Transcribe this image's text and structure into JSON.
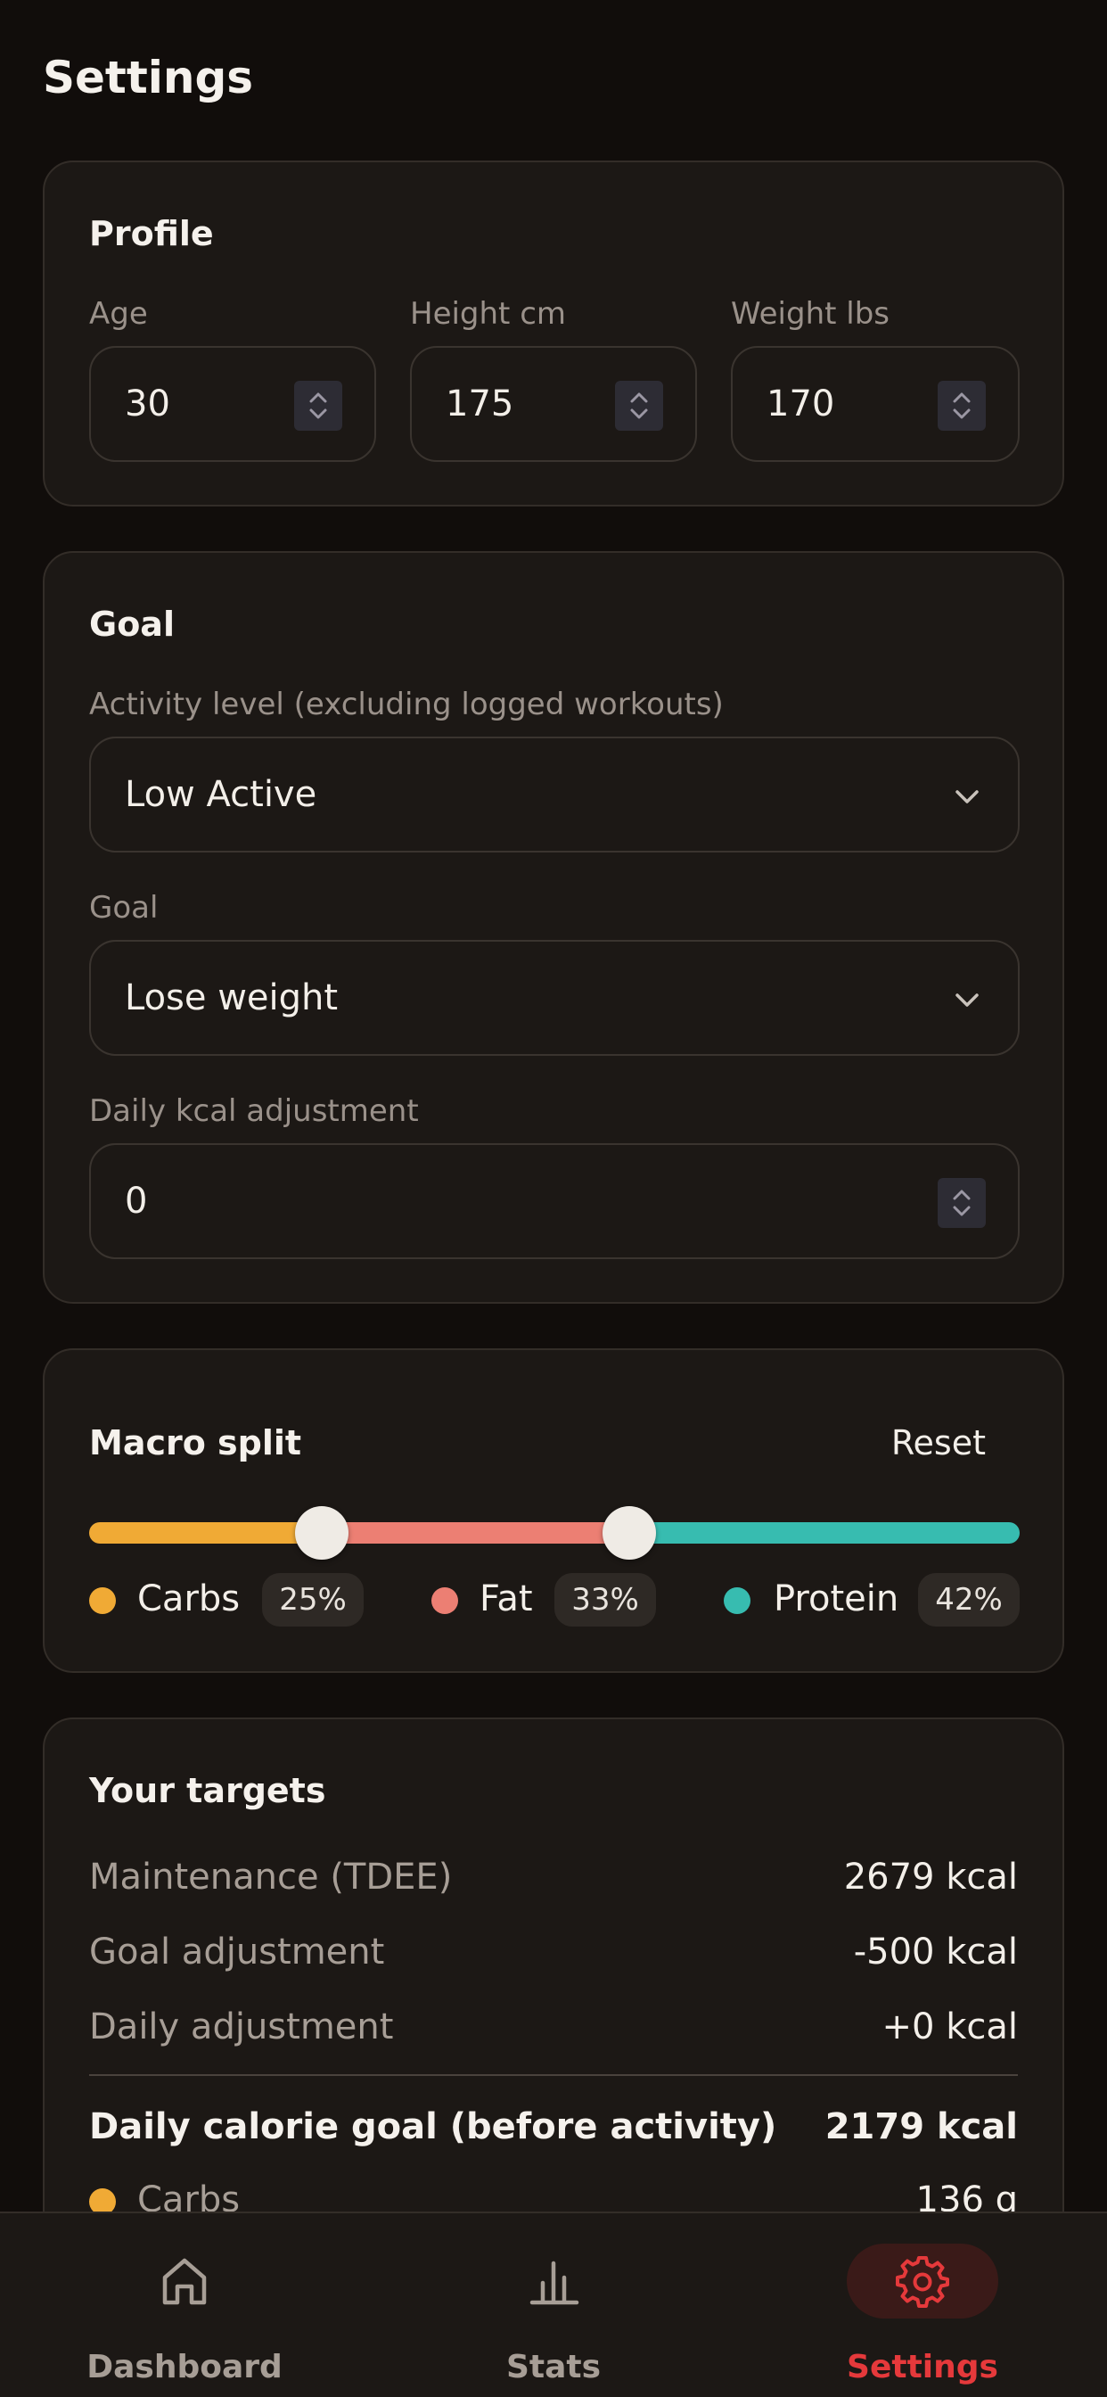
{
  "page": {
    "title": "Settings"
  },
  "profile": {
    "title": "Profile",
    "fields": [
      {
        "label": "Age",
        "value": "30"
      },
      {
        "label": "Height cm",
        "value": "175"
      },
      {
        "label": "Weight lbs",
        "value": "170"
      }
    ]
  },
  "goal": {
    "title": "Goal",
    "activity_label": "Activity level (excluding logged workouts)",
    "activity_value": "Low Active",
    "goal_label": "Goal",
    "goal_value": "Lose weight",
    "kcal_label": "Daily kcal adjustment",
    "kcal_value": "0"
  },
  "macro": {
    "title": "Macro split",
    "reset_label": "Reset",
    "carbs_percent": 25,
    "fat_percent": 33,
    "protein_percent": 42,
    "legend": [
      {
        "name": "Carbs",
        "pct": "25%",
        "color": "#f0aa35"
      },
      {
        "name": "Fat",
        "pct": "33%",
        "color": "#ec7f73"
      },
      {
        "name": "Protein",
        "pct": "42%",
        "color": "#37bcb0"
      }
    ]
  },
  "targets": {
    "title": "Your targets",
    "rows": [
      {
        "label": "Maintenance (TDEE)",
        "value": "2679 kcal"
      },
      {
        "label": "Goal adjustment",
        "value": "-500 kcal"
      },
      {
        "label": "Daily adjustment",
        "value": "+0 kcal"
      }
    ],
    "total_label": "Daily calorie goal (before activity)",
    "total_value": "2179 kcal",
    "macro_rows": [
      {
        "label": "Carbs",
        "value": "136 g",
        "color": "#f0aa35"
      }
    ]
  },
  "nav": {
    "items": [
      {
        "label": "Dashboard",
        "icon": "home-icon",
        "active": false
      },
      {
        "label": "Stats",
        "icon": "bar-chart-icon",
        "active": false
      },
      {
        "label": "Settings",
        "icon": "gear-icon",
        "active": true
      }
    ],
    "active_color": "#e5393b",
    "active_bg": "#3a1a18"
  }
}
